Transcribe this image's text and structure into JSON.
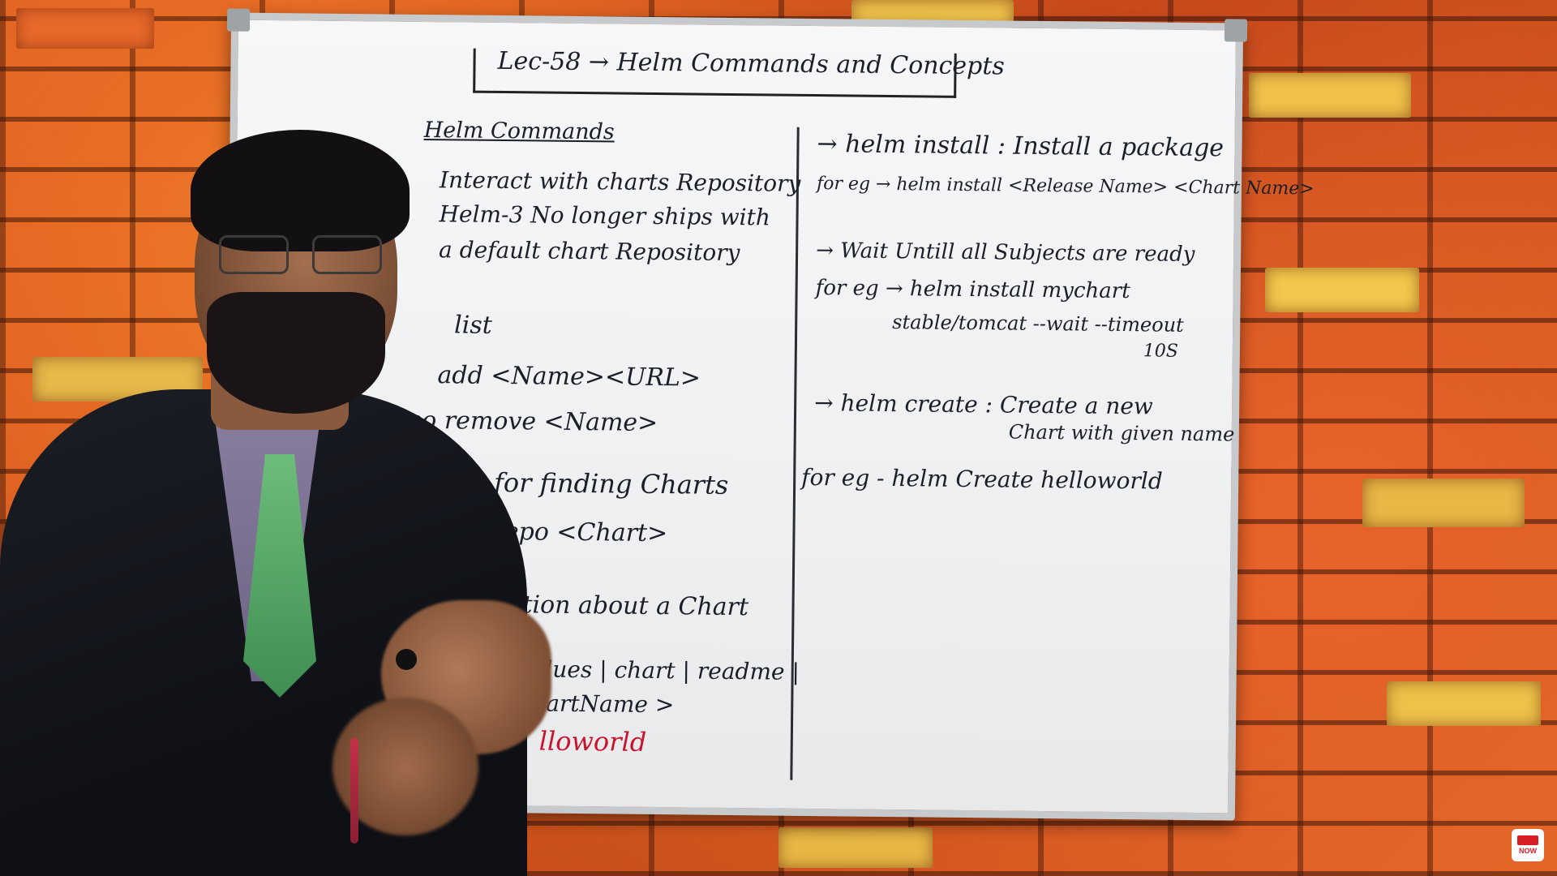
{
  "board": {
    "title": "Lec-58 → Helm Commands and Concepts",
    "left": {
      "heading": "Helm Commands",
      "lines": [
        "Interact with charts Repository",
        "Helm-3 No longer ships with",
        "a default chart Repository",
        "list",
        "add <Name><URL>",
        "repo remove <Name>",
        ": for finding Charts",
        "repo <Chart>",
        "ation about a Chart",
        "alues | chart | readme |",
        "hartName >",
        "lloworld"
      ]
    },
    "right": {
      "lines": [
        "→ helm install : Install a package",
        "for eg → helm install <Release Name> <Chart Name>",
        "→ Wait Untill all Subjects are ready",
        "for eg → helm install mychart",
        "stable/tomcat --wait --timeout",
        "10S",
        "→ helm create : Create a new",
        "Chart with given name",
        "for eg - helm Create helloworld"
      ]
    }
  },
  "badge": {
    "top": "SUBSCRIBE",
    "bottom": "NOW"
  },
  "colors": {
    "ink": "#1b1f2a",
    "red_ink": "#c8152e",
    "brick": "#d8501e",
    "board": "#f4f5f6"
  }
}
